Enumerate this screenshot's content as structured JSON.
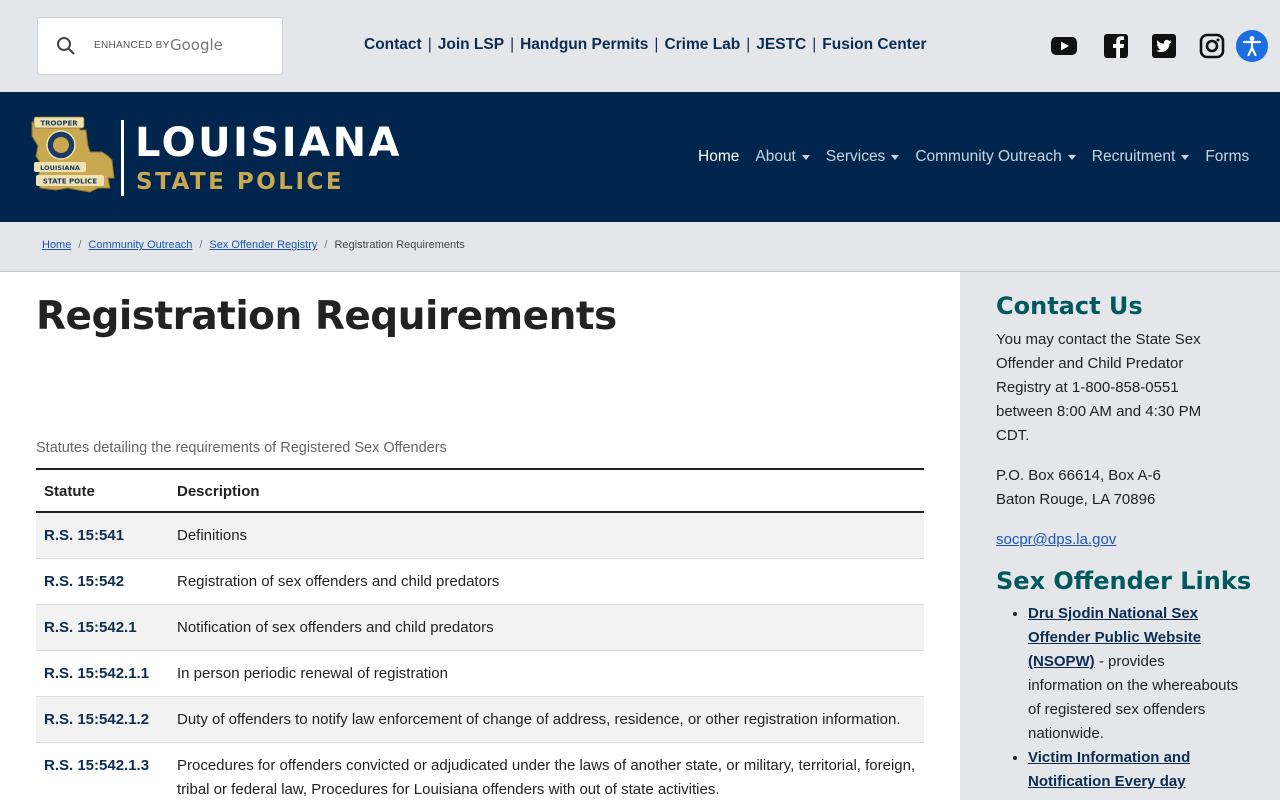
{
  "search": {
    "enhanced_by": "ENHANCED BY",
    "google": "Google"
  },
  "utility_links": [
    "Contact",
    "Join LSP",
    "Handgun Permits",
    "Crime Lab",
    "JESTC",
    "Fusion Center"
  ],
  "social_icons": [
    "youtube-icon",
    "facebook-icon",
    "twitter-icon",
    "instagram-icon"
  ],
  "accessibility_icon": "accessibility-icon",
  "logo": {
    "main": "LOUISIANA",
    "sub": "STATE POLICE",
    "badge_top": "TROOPER",
    "badge_mid": "LOUISIANA",
    "badge_bottom": "STATE POLICE"
  },
  "nav": [
    {
      "label": "Home",
      "active": true,
      "dropdown": false
    },
    {
      "label": "About",
      "active": false,
      "dropdown": true
    },
    {
      "label": "Services",
      "active": false,
      "dropdown": true
    },
    {
      "label": "Community Outreach",
      "active": false,
      "dropdown": true
    },
    {
      "label": "Recruitment",
      "active": false,
      "dropdown": true
    },
    {
      "label": "Forms",
      "active": false,
      "dropdown": false
    }
  ],
  "breadcrumb": {
    "home": "Home",
    "outreach": "Community Outreach",
    "registry": "Sex Offender Registry",
    "current": "Registration Requirements"
  },
  "page": {
    "title": "Registration Requirements",
    "caption": "Statutes detailing the requirements of Registered Sex Offenders",
    "table": {
      "headers": {
        "statute": "Statute",
        "description": "Description"
      },
      "rows": [
        {
          "statute": "R.S. 15:541",
          "description": "Definitions"
        },
        {
          "statute": "R.S. 15:542",
          "description": "Registration of sex offenders and child predators"
        },
        {
          "statute": "R.S. 15:542.1",
          "description": "Notification of sex offenders and child predators"
        },
        {
          "statute": "R.S. 15:542.1.1",
          "description": "In person periodic renewal of registration"
        },
        {
          "statute": "R.S. 15:542.1.2",
          "description": "Duty of offenders to notify law enforcement of change of address, residence, or other registration information."
        },
        {
          "statute": "R.S. 15:542.1.3",
          "description": "Procedures for offenders convicted or adjudicated under the laws of another state, or military, territorial, foreign, tribal or federal law, Procedures for Louisiana offenders with out of state activities."
        }
      ]
    }
  },
  "sidebar": {
    "contact_heading": "Contact Us",
    "contact_text": "You may contact the State Sex Offender and Child Predator Registry at 1-800-858-0551 between 8:00 AM and 4:30 PM CDT.",
    "address_line1": "P.O. Box 66614, Box A-6",
    "address_line2": "Baton Rouge, LA 70896",
    "email": "socpr@dps.la.gov",
    "links_heading": "Sex Offender Links",
    "links": [
      {
        "label": "Dru Sjodin National Sex Offender Public Website (NSOPW)",
        "desc": " - provides information on the whereabouts of registered sex offenders nationwide."
      },
      {
        "label": "Victim Information and Notification Every day",
        "desc": ""
      }
    ]
  }
}
